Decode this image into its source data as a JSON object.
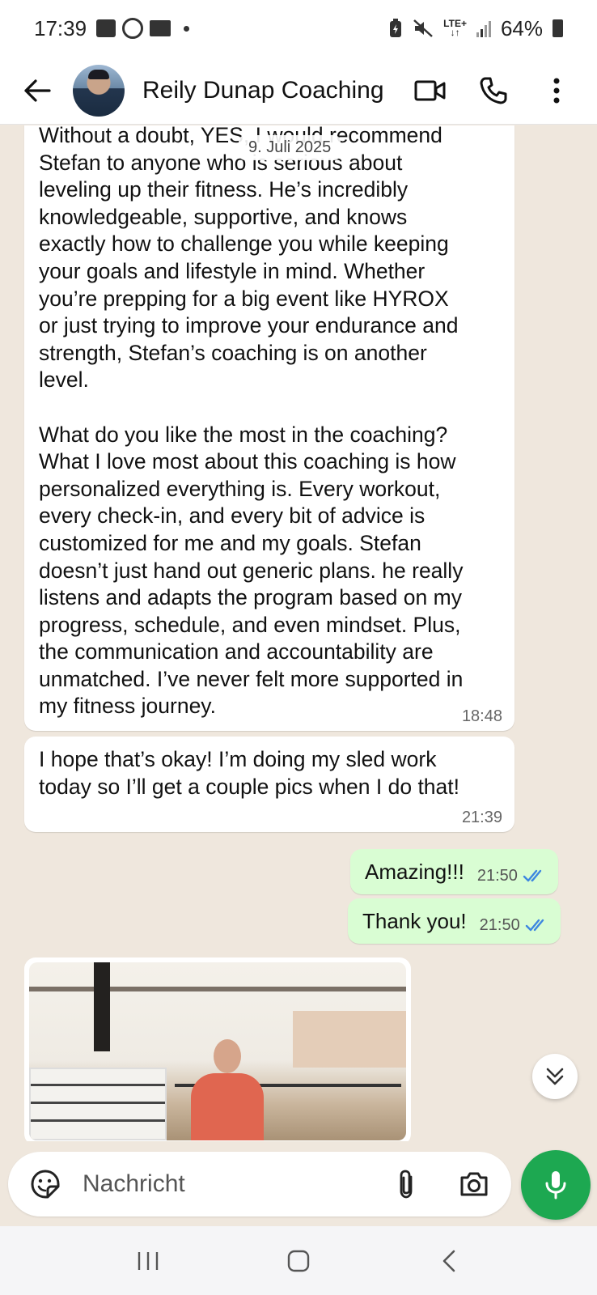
{
  "status_bar": {
    "time": "17:39",
    "network": "LTE+",
    "battery": "64%"
  },
  "header": {
    "contact_name": "Reily Dunap Coaching",
    "icons": [
      "back-arrow-icon",
      "video-call-icon",
      "voice-call-icon",
      "more-options-icon"
    ]
  },
  "chat": {
    "date_chip": "9. Juli 2025",
    "messages": [
      {
        "direction": "incoming",
        "text": "Without a doubt, YES, I would recommend\nStefan to anyone who is serious about\nleveling up their fitness. He’s incredibly\nknowledgeable, supportive, and knows\nexactly how to challenge you while keeping\nyour goals and lifestyle in mind. Whether\nyou’re prepping for a big event like HYROX\nor just trying to improve your endurance and\nstrength, Stefan’s coaching is on another\nlevel.\n\nWhat do you like the most in the coaching?\nWhat I love most about this coaching is how\npersonalized everything is. Every workout,\nevery check-in, and every bit of advice is\ncustomized for me and my goals. Stefan\ndoesn’t just hand out generic plans. he really\nlistens and adapts the program based on my\nprogress, schedule, and even mindset. Plus,\nthe communication and accountability are\nunmatched. I’ve never felt more supported in\nmy fitness journey.",
        "time": "18:48"
      },
      {
        "direction": "incoming",
        "text": "I hope that’s okay! I’m doing my sled work\ntoday so I’ll get a couple pics when I do that!",
        "time": "21:39"
      },
      {
        "direction": "outgoing",
        "text": "Amazing!!!",
        "time": "21:50",
        "status": "read"
      },
      {
        "direction": "outgoing",
        "text": "Thank you!",
        "time": "21:50",
        "status": "read"
      },
      {
        "direction": "incoming",
        "type": "image"
      }
    ]
  },
  "composer": {
    "placeholder": "Nachricht",
    "icons": [
      "emoji-sticker-icon",
      "attachment-icon",
      "camera-icon",
      "microphone-icon"
    ]
  },
  "colors": {
    "wallpaper": "#efe7dd",
    "incoming_bubble": "#ffffff",
    "outgoing_bubble": "#d9fdd3",
    "accent_green": "#1da851",
    "read_tick_blue": "#3d86e0"
  }
}
